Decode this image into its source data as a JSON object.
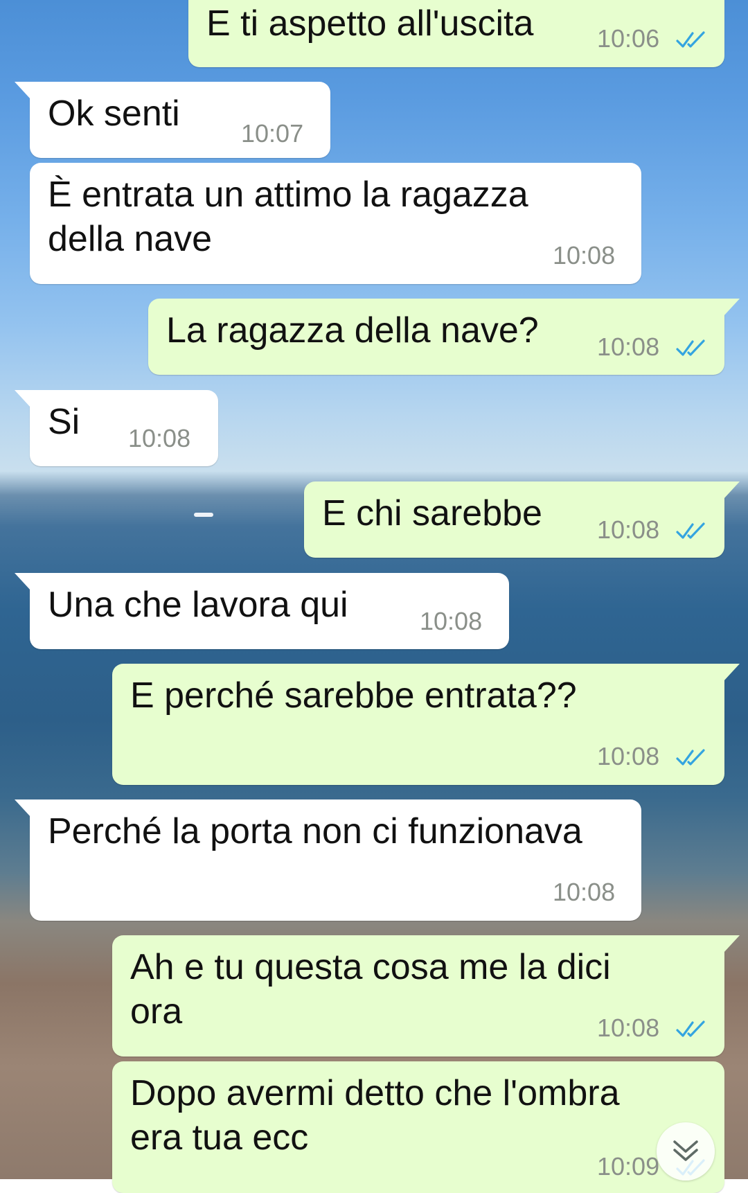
{
  "messages": [
    {
      "dir": "out",
      "text": "E ti aspetto all'uscita",
      "time": "10:06",
      "status": "read"
    },
    {
      "dir": "in",
      "text": "Ok senti",
      "time": "10:07"
    },
    {
      "dir": "in",
      "text": "È entrata un attimo la ragazza\ndella nave",
      "time": "10:08"
    },
    {
      "dir": "out",
      "text": "La ragazza della nave?",
      "time": "10:08",
      "status": "read"
    },
    {
      "dir": "in",
      "text": "Si",
      "time": "10:08"
    },
    {
      "dir": "out",
      "text": "E chi sarebbe",
      "time": "10:08",
      "status": "read"
    },
    {
      "dir": "in",
      "text": "Una che lavora qui",
      "time": "10:08"
    },
    {
      "dir": "out",
      "text": "E perché sarebbe entrata??",
      "time": "10:08",
      "status": "read"
    },
    {
      "dir": "in",
      "text": "Perché la porta non ci funzionava",
      "time": "10:08"
    },
    {
      "dir": "out",
      "text": "Ah e tu questa cosa me la dici\nora",
      "time": "10:08",
      "status": "read"
    },
    {
      "dir": "out",
      "text": "Dopo avermi detto che l'ombra\nera tua ecc",
      "time": "10:09",
      "status": "read"
    }
  ],
  "colors": {
    "incoming_bubble": "#ffffff",
    "outgoing_bubble": "#e7fecf",
    "read_ticks": "#34a4e0",
    "timestamp": "#8a8f89"
  },
  "icons": {
    "read_status": "double-check-icon",
    "scroll_down": "double-chevron-down-icon"
  }
}
